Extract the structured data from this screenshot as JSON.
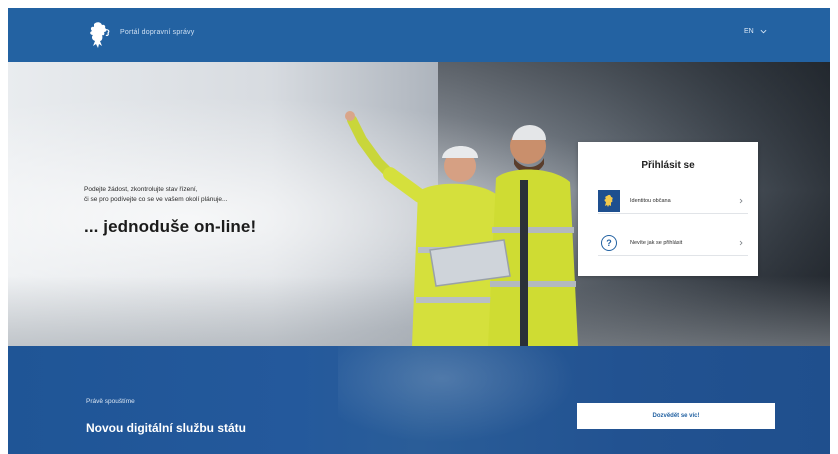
{
  "header": {
    "brand": "Portál dopravní správy",
    "language": "EN",
    "colors": {
      "bar": "#2362a2"
    },
    "logo_icon": "lion-emblem-icon"
  },
  "hero": {
    "tagline_line1": "Podejte žádost, zkontrolujte stav řízení,",
    "tagline_line2": "či se pro podívejte co se ve vašem okolí plánuje...",
    "headline": "... jednoduše on-line!"
  },
  "login": {
    "title": "Přihlásit se",
    "options": [
      {
        "label": "Identitou občana",
        "icon": "identity-badge-icon"
      },
      {
        "label": "Nevíte jak se přihlásit",
        "icon": "question-circle-icon"
      }
    ]
  },
  "banner": {
    "kicker": "Právě spouštíme",
    "title": "Novou digitální službu státu",
    "cta_label": "Dozvědět se víc!",
    "colors": {
      "background": "#2362a2",
      "cta_text": "#2362a2"
    }
  }
}
